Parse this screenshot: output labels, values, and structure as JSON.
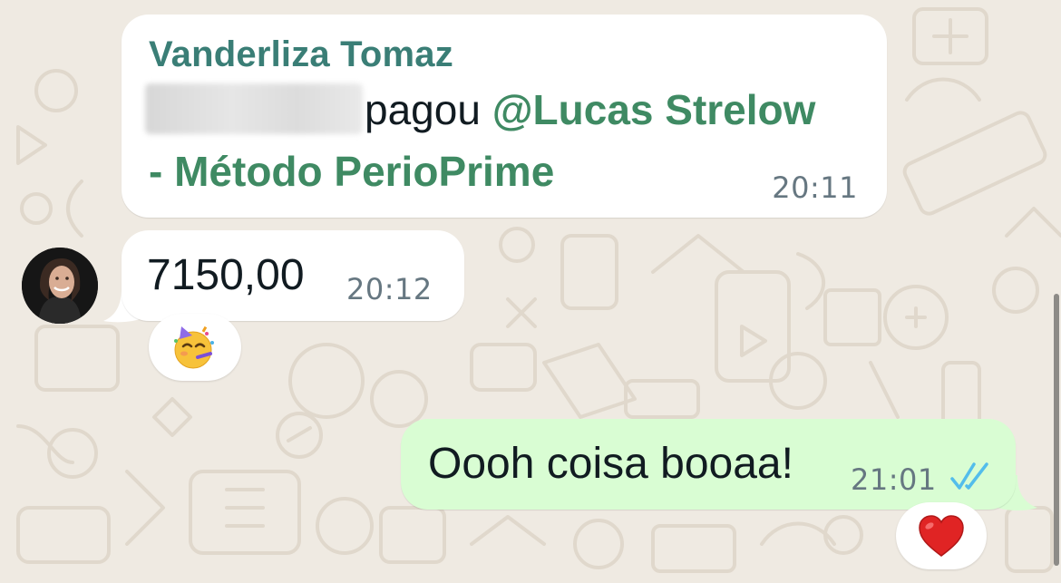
{
  "chat": {
    "messages": [
      {
        "direction": "incoming",
        "sender": "Vanderliza Tomaz",
        "text_visible": "pagou",
        "mention": "@Lucas Strelow",
        "mention_continued": "- Método PerioPrime",
        "time": "20:11"
      },
      {
        "direction": "incoming",
        "text": "7150,00",
        "time": "20:12",
        "reaction": "🥳"
      },
      {
        "direction": "outgoing",
        "text": "Oooh coisa booaa!",
        "time": "21:01",
        "status": "read",
        "reaction": "❤️"
      }
    ]
  },
  "colors": {
    "wallpaper": "#efeae2",
    "incoming_bubble": "#ffffff",
    "outgoing_bubble": "#d9fdd3",
    "sender_name": "#3a7e76",
    "mention": "#3f8a63",
    "timestamp": "#667781",
    "read_ticks": "#53bdeb"
  },
  "icons": {
    "read_receipt": "double-check-icon",
    "avatar": "avatar"
  }
}
